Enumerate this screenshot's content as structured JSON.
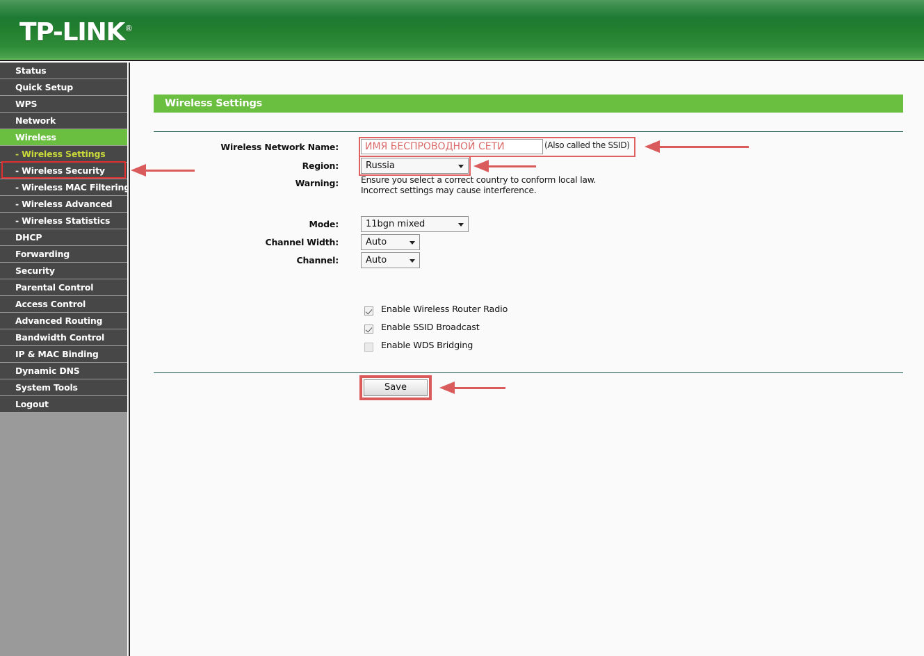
{
  "header": {
    "brand": "TP-LINK",
    "registered_mark": "®"
  },
  "sidebar": {
    "items": [
      {
        "label": "Status",
        "type": "main",
        "state": "normal"
      },
      {
        "label": "Quick Setup",
        "type": "main",
        "state": "normal"
      },
      {
        "label": "WPS",
        "type": "main",
        "state": "normal"
      },
      {
        "label": "Network",
        "type": "main",
        "state": "normal"
      },
      {
        "label": "Wireless",
        "type": "main",
        "state": "active-parent"
      },
      {
        "label": "- Wireless Settings",
        "type": "sub",
        "state": "active-sub"
      },
      {
        "label": "- Wireless Security",
        "type": "sub",
        "state": "normal"
      },
      {
        "label": "- Wireless MAC Filtering",
        "type": "sub",
        "state": "normal"
      },
      {
        "label": "- Wireless Advanced",
        "type": "sub",
        "state": "normal"
      },
      {
        "label": "- Wireless Statistics",
        "type": "sub",
        "state": "normal"
      },
      {
        "label": "DHCP",
        "type": "main",
        "state": "normal"
      },
      {
        "label": "Forwarding",
        "type": "main",
        "state": "normal"
      },
      {
        "label": "Security",
        "type": "main",
        "state": "normal"
      },
      {
        "label": "Parental Control",
        "type": "main",
        "state": "normal"
      },
      {
        "label": "Access Control",
        "type": "main",
        "state": "normal"
      },
      {
        "label": "Advanced Routing",
        "type": "main",
        "state": "normal"
      },
      {
        "label": "Bandwidth Control",
        "type": "main",
        "state": "normal"
      },
      {
        "label": "IP & MAC Binding",
        "type": "main",
        "state": "normal"
      },
      {
        "label": "Dynamic DNS",
        "type": "main",
        "state": "normal"
      },
      {
        "label": "System Tools",
        "type": "main",
        "state": "normal"
      },
      {
        "label": "Logout",
        "type": "main",
        "state": "normal"
      }
    ]
  },
  "page": {
    "title": "Wireless Settings"
  },
  "form": {
    "ssid": {
      "label": "Wireless Network Name:",
      "value": "ИМЯ БЕСПРОВОДНОЙ СЕТИ",
      "hint": "(Also called the SSID)"
    },
    "region": {
      "label": "Region:",
      "value": "Russia"
    },
    "warning": {
      "label": "Warning:",
      "line1": "Ensure you select a correct country to conform local law.",
      "line2": "Incorrect settings may cause interference."
    },
    "mode": {
      "label": "Mode:",
      "value": "11bgn mixed"
    },
    "channel_width": {
      "label": "Channel Width:",
      "value": "Auto"
    },
    "channel": {
      "label": "Channel:",
      "value": "Auto"
    },
    "checkboxes": [
      {
        "label": "Enable Wireless Router Radio",
        "checked": true,
        "disabled": false
      },
      {
        "label": "Enable SSID Broadcast",
        "checked": true,
        "disabled": false
      },
      {
        "label": "Enable WDS Bridging",
        "checked": false,
        "disabled": true
      }
    ],
    "save_label": "Save"
  },
  "colors": {
    "header_green": "#1d7a32",
    "accent_green": "#6abf40",
    "sidebar_item": "#474747",
    "active_sub_text": "#c9d93a",
    "annotation_red": "#d95b5b",
    "ssid_text": "#d96a6a"
  }
}
